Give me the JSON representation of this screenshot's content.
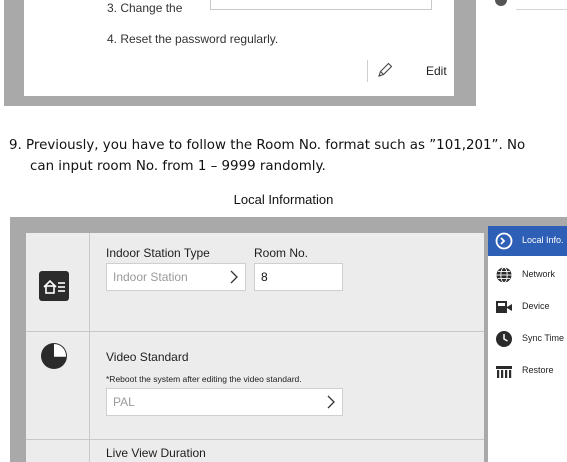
{
  "top_screenshot": {
    "step3_text": "3. Change the",
    "step4_text": "4. Reset the password regularly.",
    "edit_label": "Edit"
  },
  "instruction": {
    "line1": "9.  Previously, you have to follow the Room No. format such as ”101,201”. No",
    "line2": "can input room No. from 1 – 9999 randomly."
  },
  "caption": "Local Information",
  "settings": {
    "indoor_station_type_label": "Indoor Station Type",
    "indoor_station_type_value": "Indoor Station",
    "room_no_label": "Room No.",
    "room_no_value": "8",
    "video_standard_label": "Video Standard",
    "video_standard_note": "*Reboot the system after editing the video standard.",
    "video_standard_value": "PAL",
    "live_view_duration_label": "Live View Duration"
  },
  "sidebar": {
    "items": [
      {
        "label": "Local Info.",
        "icon": "local-info-icon",
        "active": true
      },
      {
        "label": "Network",
        "icon": "globe-icon",
        "active": false
      },
      {
        "label": "Device",
        "icon": "device-icon",
        "active": false
      },
      {
        "label": "Sync Time",
        "icon": "clock-icon",
        "active": false
      },
      {
        "label": "Restore",
        "icon": "restore-icon",
        "active": false
      }
    ]
  },
  "colors": {
    "active_item": "#2e5fb6",
    "screenshot_frame": "#a9a9a9",
    "panel_bg": "#ececec"
  }
}
